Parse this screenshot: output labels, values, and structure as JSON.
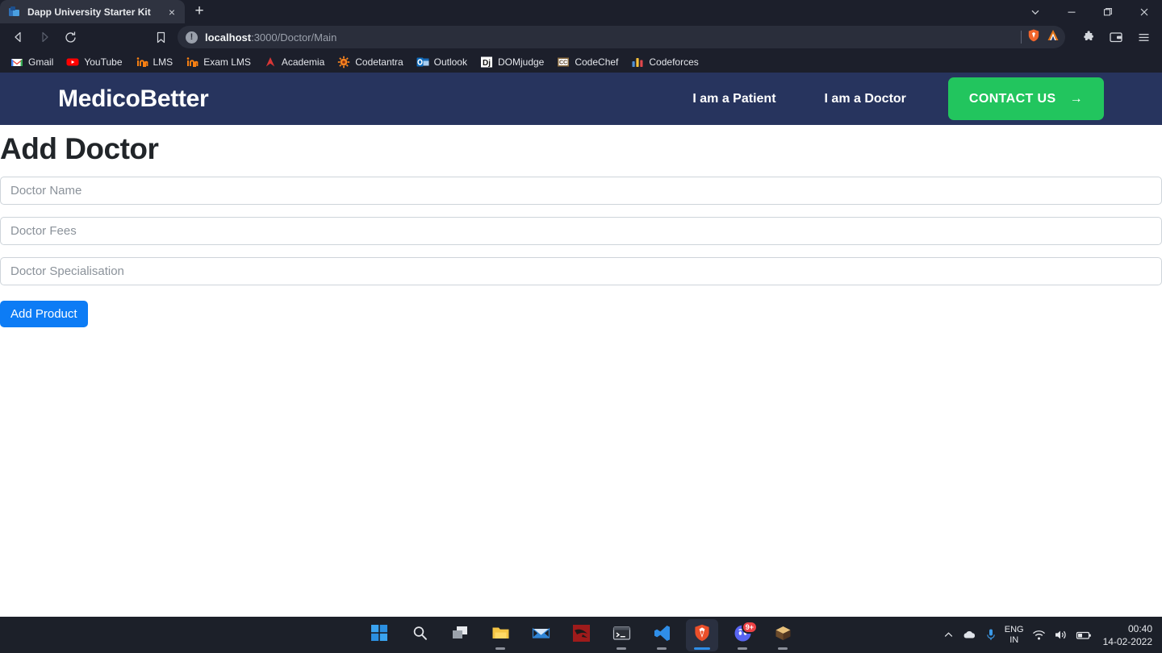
{
  "browser": {
    "tab": {
      "title": "Dapp University Starter Kit",
      "favicon": "dapp-university-favicon",
      "close": "×"
    },
    "new_tab": "+",
    "window_controls": [
      {
        "name": "tab-search",
        "glyph": "⌄"
      },
      {
        "name": "minimize",
        "glyph": "–"
      },
      {
        "name": "maximize",
        "glyph": "❐"
      },
      {
        "name": "close",
        "glyph": "✕"
      }
    ],
    "toolbar": {
      "back": "◁",
      "forward": "▷",
      "reload": "⟳",
      "bookmark_this": "☐",
      "url_prefix": "localhost",
      "url_suffix": ":3000/Doctor/Main",
      "site_info_glyph": "!",
      "shield_icon": "brave-shields-icon",
      "wallet_ext_icon": "metamask-icon",
      "extensions_icon": "extensions-puzzle-icon",
      "wallet_icon": "brave-wallet-icon",
      "menu_icon": "browser-menu-icon"
    },
    "bookmarks": [
      {
        "label": "Gmail",
        "icon": "gmail-icon"
      },
      {
        "label": "YouTube",
        "icon": "youtube-icon"
      },
      {
        "label": "LMS",
        "icon": "moodle-icon"
      },
      {
        "label": "Exam LMS",
        "icon": "moodle-icon"
      },
      {
        "label": "Academia",
        "icon": "academia-icon"
      },
      {
        "label": "Codetantra",
        "icon": "codetantra-icon"
      },
      {
        "label": "Outlook",
        "icon": "outlook-icon"
      },
      {
        "label": "DOMjudge",
        "icon": "domjudge-icon"
      },
      {
        "label": "CodeChef",
        "icon": "codechef-icon"
      },
      {
        "label": "Codeforces",
        "icon": "codeforces-icon"
      }
    ]
  },
  "site": {
    "brand": "MedicoBetter",
    "nav_links": [
      {
        "label": "I am a Patient"
      },
      {
        "label": "I am a Doctor"
      }
    ],
    "cta": {
      "label": "CONTACT US",
      "arrow": "→"
    },
    "colors": {
      "navbar_bg": "#27345e",
      "cta_bg": "#22c55e",
      "submit_bg": "#0d7cf5"
    }
  },
  "main": {
    "title": "Add Doctor",
    "fields": [
      {
        "placeholder": "Doctor Name",
        "value": "",
        "name": "doctor-name-input"
      },
      {
        "placeholder": "Doctor Fees",
        "value": "",
        "name": "doctor-fees-input"
      },
      {
        "placeholder": "Doctor Specialisation",
        "value": "",
        "name": "doctor-specialisation-input"
      }
    ],
    "submit_label": "Add Product"
  },
  "taskbar": {
    "items": [
      {
        "name": "start-button",
        "icon": "windows-start-icon",
        "active": false,
        "running": false
      },
      {
        "name": "search-button",
        "icon": "search-icon",
        "active": false,
        "running": false
      },
      {
        "name": "task-view-button",
        "icon": "task-view-icon",
        "active": false,
        "running": false
      },
      {
        "name": "file-explorer",
        "icon": "file-explorer-icon",
        "active": false,
        "running": true
      },
      {
        "name": "mail-app",
        "icon": "mail-icon",
        "active": false,
        "running": false
      },
      {
        "name": "kali-linux",
        "icon": "kali-linux-icon",
        "active": false,
        "running": false
      },
      {
        "name": "terminal",
        "icon": "terminal-icon",
        "active": false,
        "running": true
      },
      {
        "name": "vs-code",
        "icon": "vscode-icon",
        "active": false,
        "running": true
      },
      {
        "name": "brave-browser",
        "icon": "brave-icon",
        "active": true,
        "running": true
      },
      {
        "name": "discord",
        "icon": "discord-icon",
        "active": false,
        "running": true,
        "badge": "9+"
      },
      {
        "name": "minecraft",
        "icon": "minecraft-icon",
        "active": false,
        "running": true
      }
    ],
    "tray": {
      "overflow": "∧",
      "onedrive": "onedrive-icon",
      "microphone": "microphone-icon",
      "language_line1": "ENG",
      "language_line2": "IN",
      "wifi": "wifi-icon",
      "volume": "volume-icon",
      "battery": "battery-icon",
      "time": "00:40",
      "date": "14-02-2022"
    }
  }
}
